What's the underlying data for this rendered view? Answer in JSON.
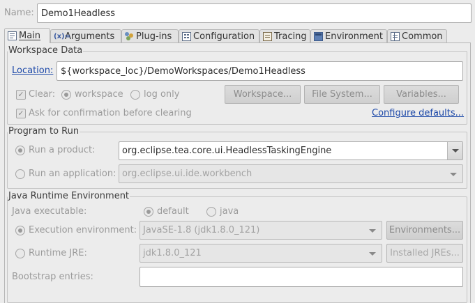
{
  "name": {
    "label": "Name:",
    "value": "Demo1Headless"
  },
  "tabs": [
    {
      "label": "Main",
      "icon": "main-icon"
    },
    {
      "label": "Arguments",
      "icon": "arguments-icon"
    },
    {
      "label": "Plug-ins",
      "icon": "plugins-icon"
    },
    {
      "label": "Configuration",
      "icon": "configuration-icon"
    },
    {
      "label": "Tracing",
      "icon": "tracing-icon"
    },
    {
      "label": "Environment",
      "icon": "environment-icon"
    },
    {
      "label": "Common",
      "icon": "common-icon"
    }
  ],
  "workspace": {
    "title": "Workspace Data",
    "location_label": "Location:",
    "location_value": "${workspace_loc}/DemoWorkspaces/Demo1Headless",
    "clear_label": "Clear:",
    "clear_checked": true,
    "clear_workspace_label": "workspace",
    "clear_log_label": "log only",
    "workspace_btn": "Workspace...",
    "filesystem_btn": "File System...",
    "variables_btn": "Variables...",
    "ask_label": "Ask for confirmation before clearing",
    "ask_checked": true,
    "configure_link": "Configure defaults..."
  },
  "program": {
    "title": "Program to Run",
    "product_label": "Run a product:",
    "product_value": "org.eclipse.tea.core.ui.HeadlessTaskingEngine",
    "application_label": "Run an application:",
    "application_value": "org.eclipse.ui.ide.workbench"
  },
  "jre": {
    "title": "Java Runtime Environment",
    "executable_label": "Java executable:",
    "default_label": "default",
    "java_label": "java",
    "exec_env_label": "Execution environment:",
    "exec_env_value": "JavaSE-1.8 (jdk1.8.0_121)",
    "environments_btn": "Environments...",
    "runtime_jre_label": "Runtime JRE:",
    "runtime_jre_value": "jdk1.8.0_121",
    "installed_jres_btn": "Installed JREs...",
    "bootstrap_label": "Bootstrap entries:",
    "bootstrap_value": ""
  },
  "colors": {
    "link": "#1c48a8",
    "background": "#ececec"
  }
}
